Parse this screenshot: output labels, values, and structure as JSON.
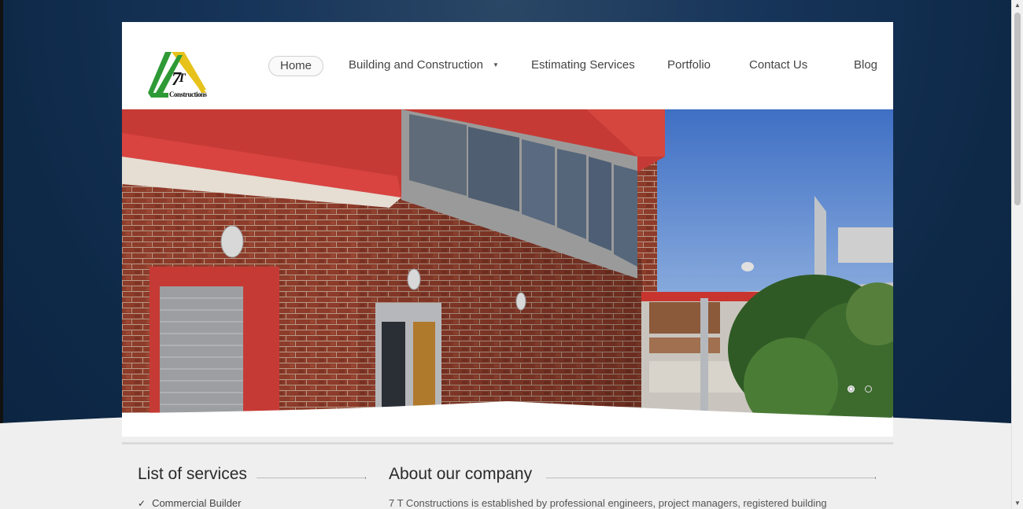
{
  "header": {
    "logo_text": "7T",
    "logo_subtext": "Constructions"
  },
  "nav": {
    "items": [
      {
        "label": "Home",
        "active": true
      },
      {
        "label": "Building and Construction",
        "has_dropdown": true
      },
      {
        "label": "Estimating Services"
      },
      {
        "label": "Portfolio"
      },
      {
        "label": "Contact Us"
      },
      {
        "label": "Blog"
      }
    ]
  },
  "slider": {
    "slide_count": 2,
    "active_slide": 1
  },
  "services": {
    "title": "List of services",
    "items": [
      "Commercial Builder"
    ]
  },
  "about": {
    "title": "About our company",
    "text": "7 T Constructions is established by professional engineers, project managers, registered building"
  },
  "colors": {
    "page_background": "#0e2948",
    "content_background": "#ffffff",
    "lower_background": "#efefef",
    "logo_green": "#2e9a35",
    "logo_yellow": "#e6c21a"
  }
}
